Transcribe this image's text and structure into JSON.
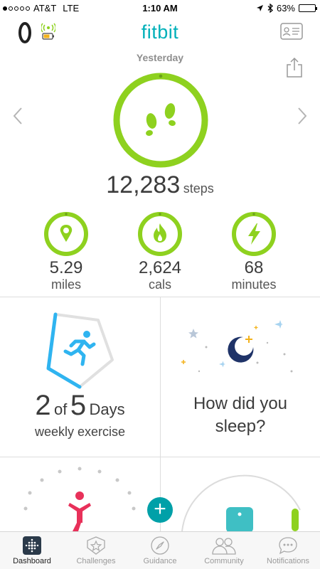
{
  "status_bar": {
    "carrier": "AT&T",
    "network": "LTE",
    "time": "1:10 AM",
    "battery": "63%",
    "battery_level": 0.63
  },
  "header": {
    "logo": "fitbit",
    "day": "Yesterday"
  },
  "steps": {
    "value": "12,283",
    "unit": "steps",
    "progress": 1.0
  },
  "metrics": [
    {
      "value": "5.29",
      "unit": "miles",
      "icon": "location-pin-icon"
    },
    {
      "value": "2,624",
      "unit": "cals",
      "icon": "flame-icon"
    },
    {
      "value": "68",
      "unit": "minutes",
      "icon": "lightning-bolt-icon"
    }
  ],
  "exercise": {
    "done": "2",
    "of_word": "of",
    "goal": "5",
    "days_word": "Days",
    "label": "weekly exercise"
  },
  "sleep": {
    "question_line1": "How did you",
    "question_line2": "sleep?"
  },
  "add_button": {
    "label": "+"
  },
  "tabs": [
    {
      "label": "Dashboard",
      "icon": "dashboard-icon",
      "active": true
    },
    {
      "label": "Challenges",
      "icon": "star-badge-icon",
      "active": false
    },
    {
      "label": "Guidance",
      "icon": "compass-icon",
      "active": false
    },
    {
      "label": "Community",
      "icon": "people-icon",
      "active": false
    },
    {
      "label": "Notifications",
      "icon": "chat-bubble-icon",
      "active": false
    }
  ],
  "colors": {
    "accent_green": "#8ed11f",
    "brand_teal": "#00b0b9",
    "exercise_blue": "#2fb4f0",
    "sleep_navy": "#1f3368",
    "yoga_pink": "#e8315a"
  }
}
